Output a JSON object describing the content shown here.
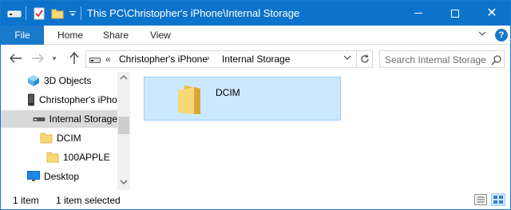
{
  "titlebar": {
    "title": "This PC\\Christopher's iPhone\\Internal Storage",
    "close_glyph": "✕"
  },
  "ribbon": {
    "file_label": "File",
    "tabs": [
      {
        "label": "Home"
      },
      {
        "label": "Share"
      },
      {
        "label": "View"
      }
    ],
    "help_label": "?"
  },
  "nav": {
    "recent_glyph": "▾",
    "breadcrumb_prefix": "«",
    "breadcrumbs": [
      "Christopher's iPhone",
      "Internal Storage"
    ],
    "separator": "›"
  },
  "search": {
    "placeholder": "Search Internal Storage"
  },
  "tree": {
    "items": [
      {
        "label": "3D Objects",
        "icon": "3d-objects-icon"
      },
      {
        "label": "Christopher's iPhone",
        "icon": "phone-icon"
      },
      {
        "label": "Internal Storage",
        "icon": "drive-icon",
        "selected": true
      },
      {
        "label": "DCIM",
        "icon": "folder-icon"
      },
      {
        "label": "100APPLE",
        "icon": "folder-icon"
      },
      {
        "label": "Desktop",
        "icon": "desktop-icon"
      }
    ]
  },
  "content": {
    "items": [
      {
        "name": "DCIM",
        "icon": "folder-icon",
        "selected": true
      }
    ]
  },
  "status": {
    "item_count": "1 item",
    "selection": "1 item selected"
  },
  "colors": {
    "titlebar": "#0c73cc",
    "file_tab": "#1979ca",
    "selection": "#cce8ff",
    "selection_border": "#99d1ff",
    "folder": "#f8d775"
  }
}
